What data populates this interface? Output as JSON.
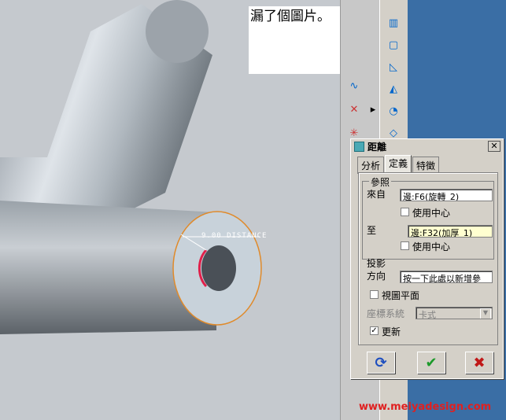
{
  "note": {
    "text": "漏了個圖片。"
  },
  "viewport": {
    "dimension_label": "9.00  DISTANCE"
  },
  "dialog": {
    "title": "距離",
    "tabs": [
      {
        "label": "分析"
      },
      {
        "label": "定義"
      },
      {
        "label": "特徵"
      }
    ],
    "reference_group_label": "參照",
    "from_label": "來自",
    "from_value": "邊:F6(旋轉_2)",
    "use_center_1": "使用中心",
    "to_label": "至",
    "to_value": "邊:F32(加厚_1)",
    "use_center_2": "使用中心",
    "projection_label": "投影",
    "direction_label": "方向",
    "direction_value": "按一下此處以新增參",
    "view_plane_label": "視圖平面",
    "coord_label": "座標系統",
    "coord_value": "卡式",
    "update_label": "更新",
    "update_checked": true
  },
  "watermark": "www.meiyadesign.com"
}
